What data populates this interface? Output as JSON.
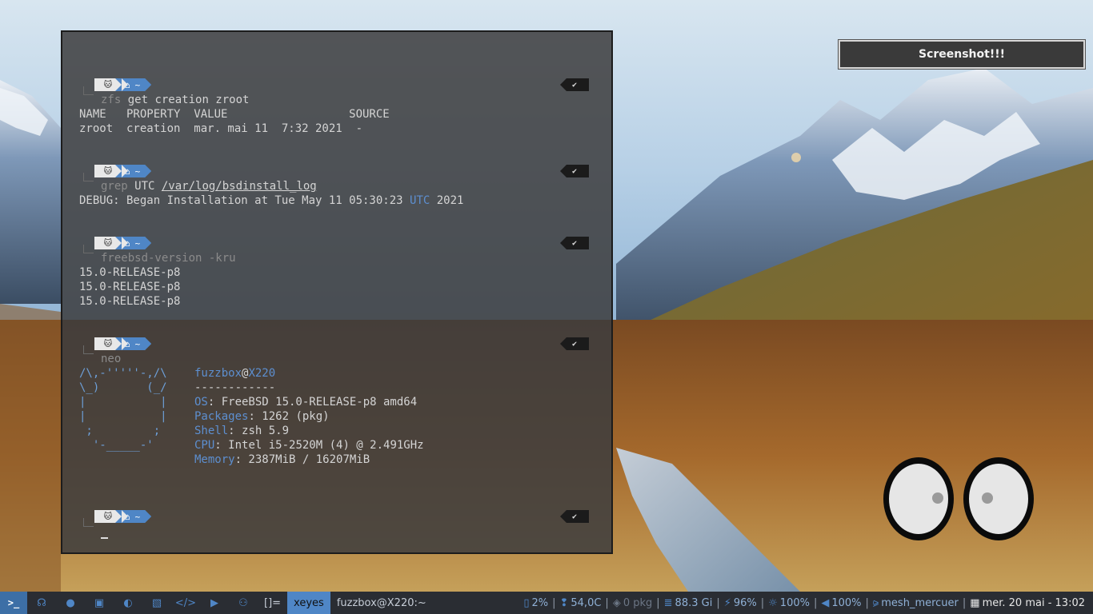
{
  "notification": {
    "text": "Screenshot!!!"
  },
  "terminal": {
    "prompt": {
      "seg1_icon": "cat-icon",
      "seg2_icon": "home-icon",
      "seg2_text": "~",
      "status": "✔"
    },
    "blocks": [
      {
        "command": "zfs",
        "args": " get creation zroot",
        "output": [
          "NAME   PROPERTY  VALUE                  SOURCE",
          "zroot  creation  mar. mai 11  7:32 2021  -"
        ]
      },
      {
        "command": "grep",
        "args_pre": " UTC ",
        "args_path": "/var/log/bsdinstall_log",
        "output_pre": "DEBUG: Began Installation at Tue May 11 05:30:23 ",
        "output_hl": "UTC",
        "output_post": " 2021"
      },
      {
        "command": "freebsd-version -kru",
        "output": [
          "15.0-RELEASE-p8",
          "15.0-RELEASE-p8",
          "15.0-RELEASE-p8"
        ]
      },
      {
        "command": "neo",
        "ascii": [
          "/\\,-'''''-,/\\",
          "\\_)       (_/",
          "|           |",
          "|           |",
          " ;         ;",
          "  '-_____-'"
        ],
        "user": "fuzzbox",
        "at": "@",
        "host": "X220",
        "rule": "------------",
        "info": [
          {
            "key": "OS",
            "value": ": FreeBSD 15.0-RELEASE-p8 amd64"
          },
          {
            "key": "Packages",
            "value": ": 1262 (pkg)"
          },
          {
            "key": "Shell",
            "value": ": zsh 5.9"
          },
          {
            "key": "CPU",
            "value": ": Intel i5-2520M (4) @ 2.491GHz"
          },
          {
            "key": "Memory",
            "value": ": 2387MiB / 16207MiB"
          }
        ]
      }
    ]
  },
  "taskbar": {
    "start_label": ">_",
    "launchers": [
      "headphones-icon",
      "user-icon",
      "briefcase-icon",
      "firefox-icon",
      "image-icon",
      "code-icon",
      "video-icon",
      "gamepad-icon"
    ],
    "layout_indicator": "[]=",
    "tasks": [
      {
        "label": "xeyes",
        "active": true
      },
      {
        "label": "fuzzbox@X220:~",
        "active": false
      }
    ],
    "status": {
      "battery_icon_text": "2%",
      "temp": "54,0C",
      "pkg": "0 pkg",
      "disk": "88.3 Gi",
      "power": "96%",
      "brightness": "100%",
      "volume": "100%",
      "wifi": "mesh_mercuer",
      "clock": "mer. 20 mai - 13:02"
    }
  },
  "colors": {
    "accent": "#4f86c6",
    "terminal_bg": "#3c3c3e",
    "taskbar_bg": "#2a2d33"
  }
}
